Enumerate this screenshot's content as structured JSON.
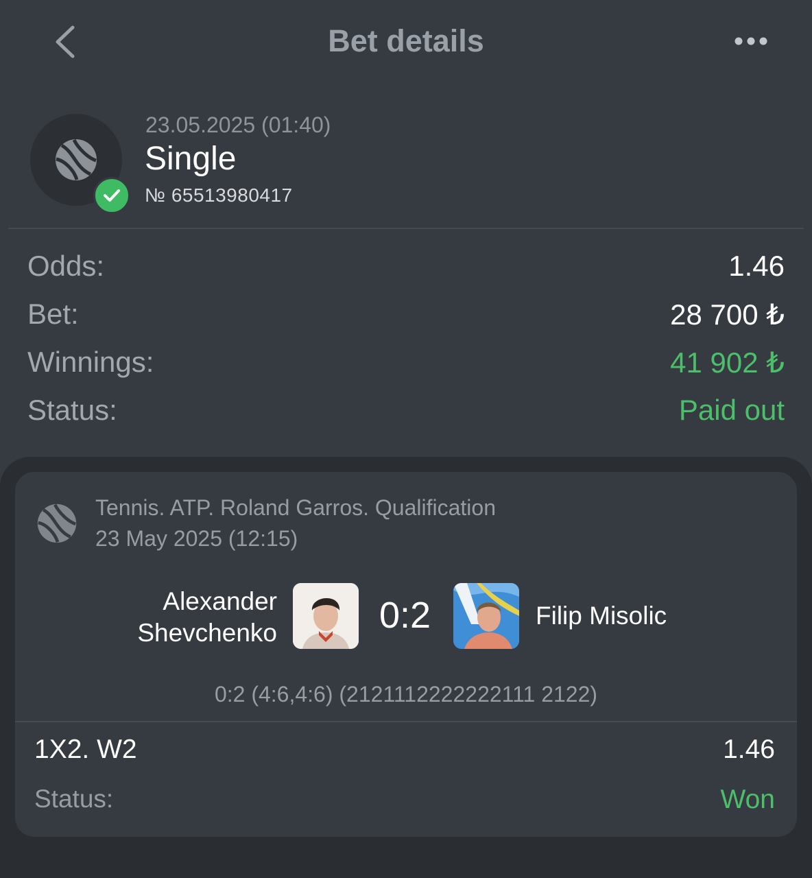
{
  "header": {
    "title": "Bet details",
    "back_icon": "chevron-left-icon",
    "more_icon": "more-horizontal-icon"
  },
  "bet": {
    "date": "23.05.2025 (01:40)",
    "type": "Single",
    "number": "№ 65513980417",
    "sport_icon": "tennis-ball-icon",
    "status_icon": "check-icon"
  },
  "details": {
    "odds_label": "Odds:",
    "odds_value": "1.46",
    "bet_label": "Bet:",
    "bet_value": "28 700 ₺",
    "winnings_label": "Winnings:",
    "winnings_value": "41 902 ₺",
    "status_label": "Status:",
    "status_value": "Paid out"
  },
  "event": {
    "tournament": "Tennis. ATP. Roland Garros. Qualification",
    "date": "23 May 2025 (12:15)",
    "player1": "Alexander Shevchenko",
    "player2": "Filip Misolic",
    "score": "0:2",
    "score_details": "0:2 (4:6,4:6) (2121112222222111 2122)",
    "market": "1X2. W2",
    "market_odds": "1.46",
    "outcome_label": "Status:",
    "outcome_value": "Won"
  },
  "colors": {
    "background": "#363b41",
    "card_outer": "#2a2e33",
    "accent_green": "#4cbf6a",
    "muted_text": "#979da3"
  }
}
